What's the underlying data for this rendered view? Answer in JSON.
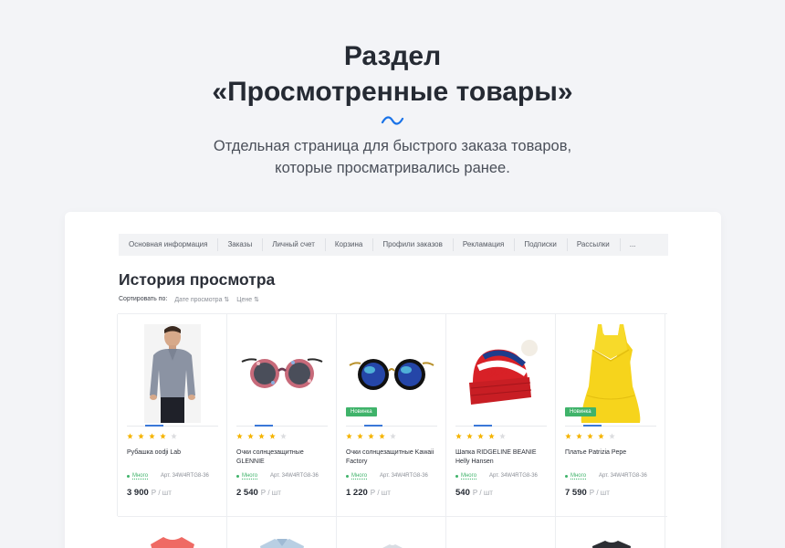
{
  "hero": {
    "title_line1": "Раздел",
    "title_line2": "«Просмотренные товары»",
    "subtitle_line1": "Отдельная страница для быстрого заказа товаров,",
    "subtitle_line2": "которые просматривались ранее."
  },
  "tabs": [
    "Основная информация",
    "Заказы",
    "Личный счет",
    "Корзина",
    "Профили заказов",
    "Рекламация",
    "Подписки",
    "Рассылки",
    "..."
  ],
  "page": {
    "title": "История просмотра",
    "sort_label": "Сортировать по:",
    "sort_date": "Дате просмотра ⇅",
    "sort_price": "Цене ⇅"
  },
  "products": [
    {
      "name": "Рубашка oodji Lab",
      "badge": "",
      "stars": 4,
      "availability": "Много",
      "sku": "Арт. 34W4RTG8-36",
      "price": "3 900",
      "unit": "Р / шт",
      "image": "shirt-man"
    },
    {
      "name": "Очки солнцезащитные GLENNIE",
      "badge": "",
      "stars": 4,
      "availability": "Много",
      "sku": "Арт. 34W4RTG8-36",
      "price": "2 540",
      "unit": "Р / шт",
      "image": "sunglasses-floral"
    },
    {
      "name": "Очки солнцезащитные Kawaii Factory",
      "badge": "Новинка",
      "stars": 4,
      "availability": "Много",
      "sku": "Арт. 34W4RTG8-36",
      "price": "1 220",
      "unit": "Р / шт",
      "image": "sunglasses-round"
    },
    {
      "name": "Шапка RIDGELINE BEANIE Helly Hansen",
      "badge": "",
      "stars": 4,
      "availability": "Много",
      "sku": "Арт. 34W4RTG8-36",
      "price": "540",
      "unit": "Р / шт",
      "image": "beanie"
    },
    {
      "name": "Платье Patrizia Pepe",
      "badge": "Новинка",
      "stars": 4,
      "availability": "Много",
      "sku": "Арт. 34W4RTG8-36",
      "price": "7 590",
      "unit": "Р / шт",
      "image": "dress-yellow"
    }
  ],
  "colors": {
    "accent": "#1a73e8",
    "green": "#3fb36a",
    "star": "#f5b400"
  }
}
